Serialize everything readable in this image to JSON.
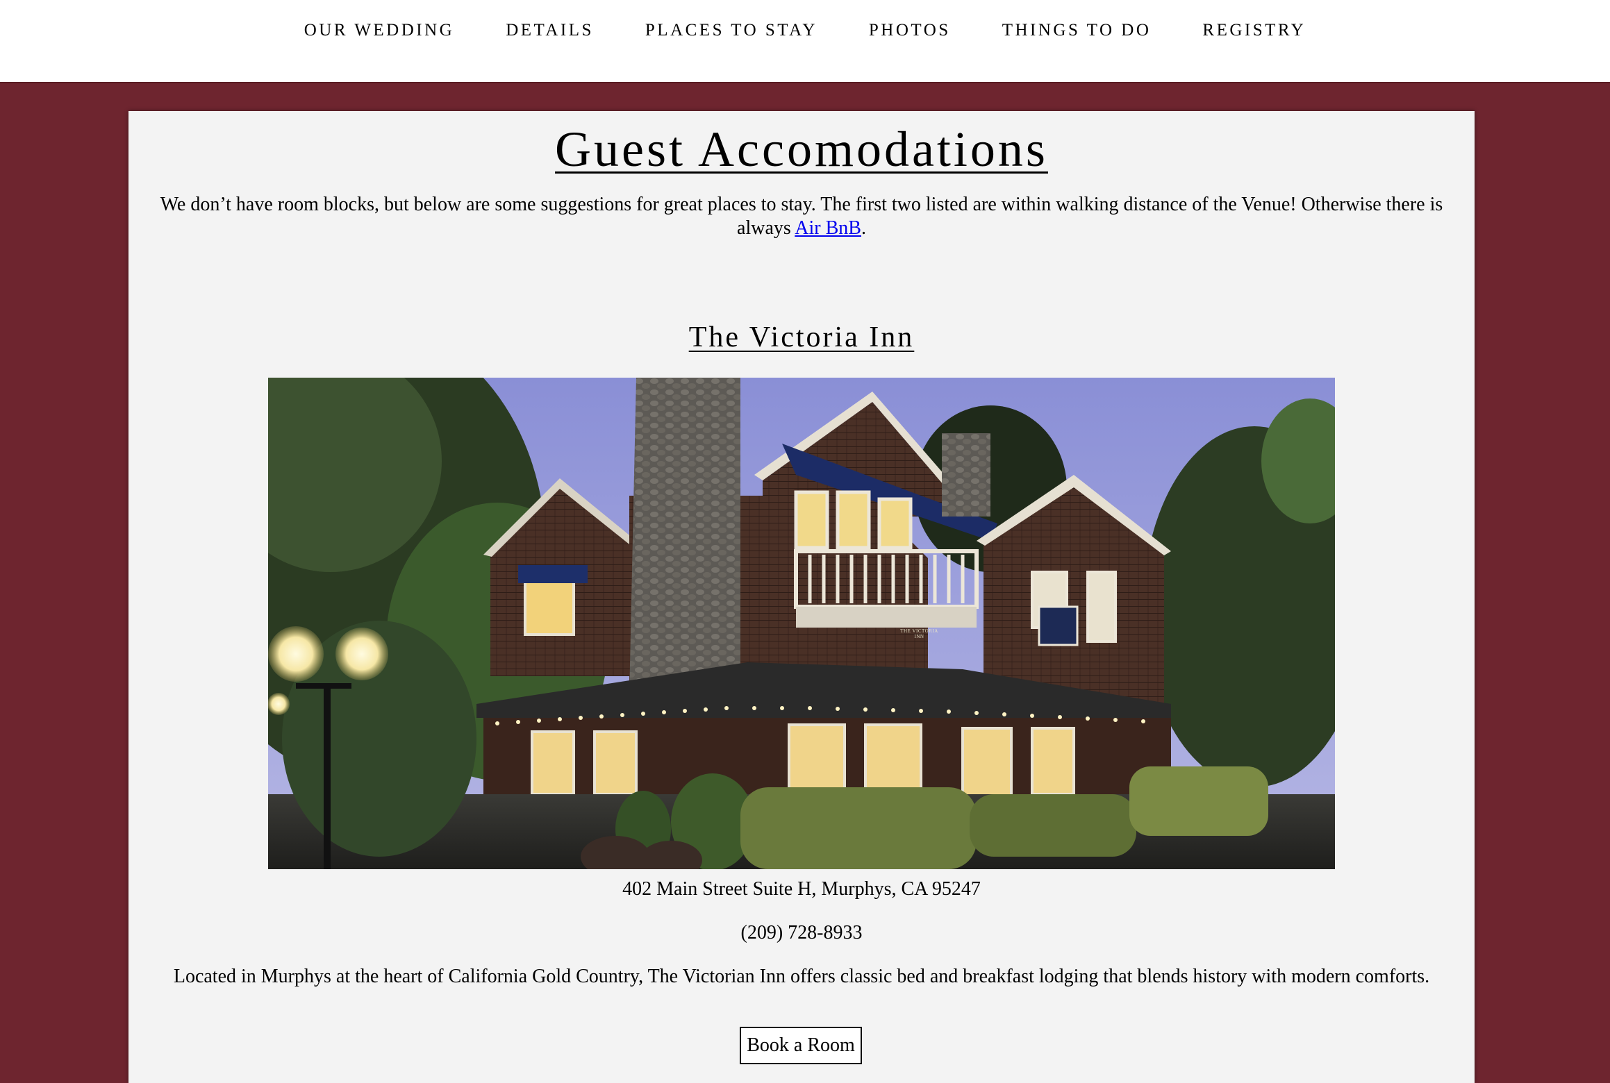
{
  "nav": {
    "items": [
      {
        "label": "OUR WEDDING"
      },
      {
        "label": "DETAILS"
      },
      {
        "label": "PLACES TO STAY"
      },
      {
        "label": "PHOTOS"
      },
      {
        "label": "THINGS TO DO"
      },
      {
        "label": "REGISTRY"
      }
    ]
  },
  "page": {
    "title": "Guest Accomodations",
    "intro_before": "We don’t have room blocks, but below are some suggestions for great places to stay. The first two listed are within walking distance of the Venue! Otherwise there is always ",
    "intro_link": "Air BnB",
    "intro_after": "."
  },
  "listing": {
    "name": "The Victoria Inn",
    "photo_sign": "THE VICTORIA INN",
    "address": "402 Main Street Suite H, Murphys, CA 95247",
    "phone": "(209) 728-8933",
    "description": "Located in Murphys at the heart of California Gold Country, The Victorian Inn offers classic bed and breakfast lodging that blends history with modern comforts.",
    "button_label": "Book a Room"
  },
  "colors": {
    "page_background": "#6e252f",
    "panel_background": "#f3f3f3",
    "link": "#0000ee"
  }
}
